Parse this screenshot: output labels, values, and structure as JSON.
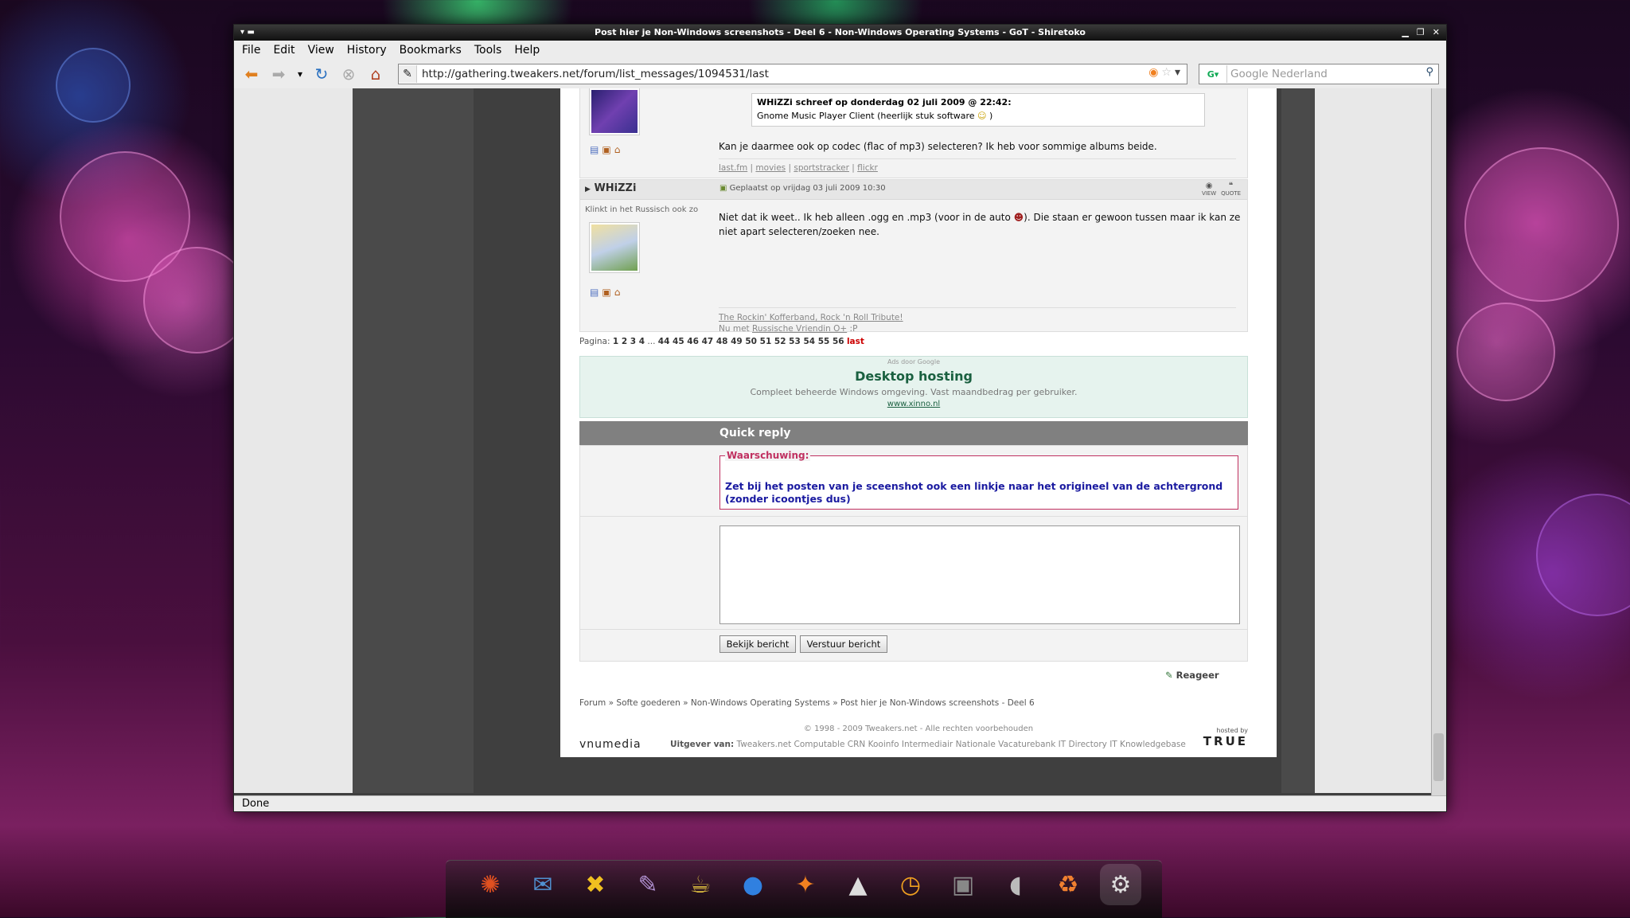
{
  "window": {
    "title": "Post hier je Non-Windows screenshots - Deel 6 - Non-Windows Operating Systems - GoT - Shiretoko"
  },
  "menu": [
    "File",
    "Edit",
    "View",
    "History",
    "Bookmarks",
    "Tools",
    "Help"
  ],
  "nav": {
    "url": "http://gathering.tweakers.net/forum/list_messages/1094531/last",
    "search_placeholder": "Google Nederland"
  },
  "post1": {
    "quote_header": "WHiZZi schreef op donderdag 02 juli 2009 @ 22:42:",
    "quote_text": "Gnome Music Player Client (heerlijk stuk software",
    "quote_end": ")",
    "message": "Kan je daarmee ook op codec (flac of mp3) selecteren? Ik heb voor sommige albums beide.",
    "sig_links": [
      "last.fm",
      "movies",
      "sportstracker",
      "flickr"
    ]
  },
  "post2": {
    "author": "WHiZZi",
    "posted": "Geplaatst op vrijdag 03 juli 2009 10:30",
    "view_label": "VIEW",
    "quote_label": "QUOTE",
    "user_title": "Klinkt in het Russisch ook zo",
    "message_line1": "Niet dat ik weet.. Ik heb alleen .ogg en .mp3 (voor in de auto",
    "message_line1_end": "). Die staan er gewoon tussen maar ik kan ze",
    "message_line2": "niet apart selecteren/zoeken nee.",
    "sig_line1": "The Rockin' Kofferband, Rock 'n Roll Tribute!",
    "sig_line2_prefix": "Nu met",
    "sig_line2_link": "Russische Vriendin O+",
    "sig_line2_suffix": ":P"
  },
  "pagination": {
    "label": "Pagina:",
    "first": "1 2 3 4",
    "ellipsis": "...",
    "pages": "44 45 46 47 48 49 50 51 52 53 54 55 56",
    "last": "last"
  },
  "ad": {
    "label": "Ads door Google",
    "title": "Desktop hosting",
    "desc": "Compleet beheerde Windows omgeving. Vast maandbedrag per gebruiker.",
    "url": "www.xinno.nl"
  },
  "quickreply": {
    "header": "Quick reply",
    "warn_label": "Waarschuwing:",
    "warn_text": "Zet bij het posten van je sceenshot ook een linkje naar het origineel van de achtergrond (zonder icoontjes dus)",
    "preview_btn": "Bekijk bericht",
    "send_btn": "Verstuur bericht",
    "reply": "Reageer"
  },
  "breadcrumb": [
    "Forum",
    "Softe goederen",
    "Non-Windows Operating Systems",
    "Post hier je Non-Windows screenshots - Deel 6"
  ],
  "footer": {
    "copyright": "© 1998 - 2009 Tweakers.net - Alle rechten voorbehouden",
    "logo": "vnumedia",
    "publisher_label": "Uitgever van:",
    "publishers": "Tweakers.net  Computable  CRN  Kooinfo  Intermediair  Nationale Vacaturebank  IT Directory  IT Knowledgebase",
    "hosted_by": "hosted by",
    "host": "TRUE"
  },
  "status": "Done",
  "dock_icons": [
    "ubuntu-icon",
    "thunderbird-icon",
    "xchat-icon",
    "pidgin-icon",
    "teapot-icon",
    "globe-icon",
    "bird-icon",
    "mountain-icon",
    "clock-icon",
    "speaker-icon",
    "volume-icon",
    "trash-icon",
    "settings-icon"
  ]
}
